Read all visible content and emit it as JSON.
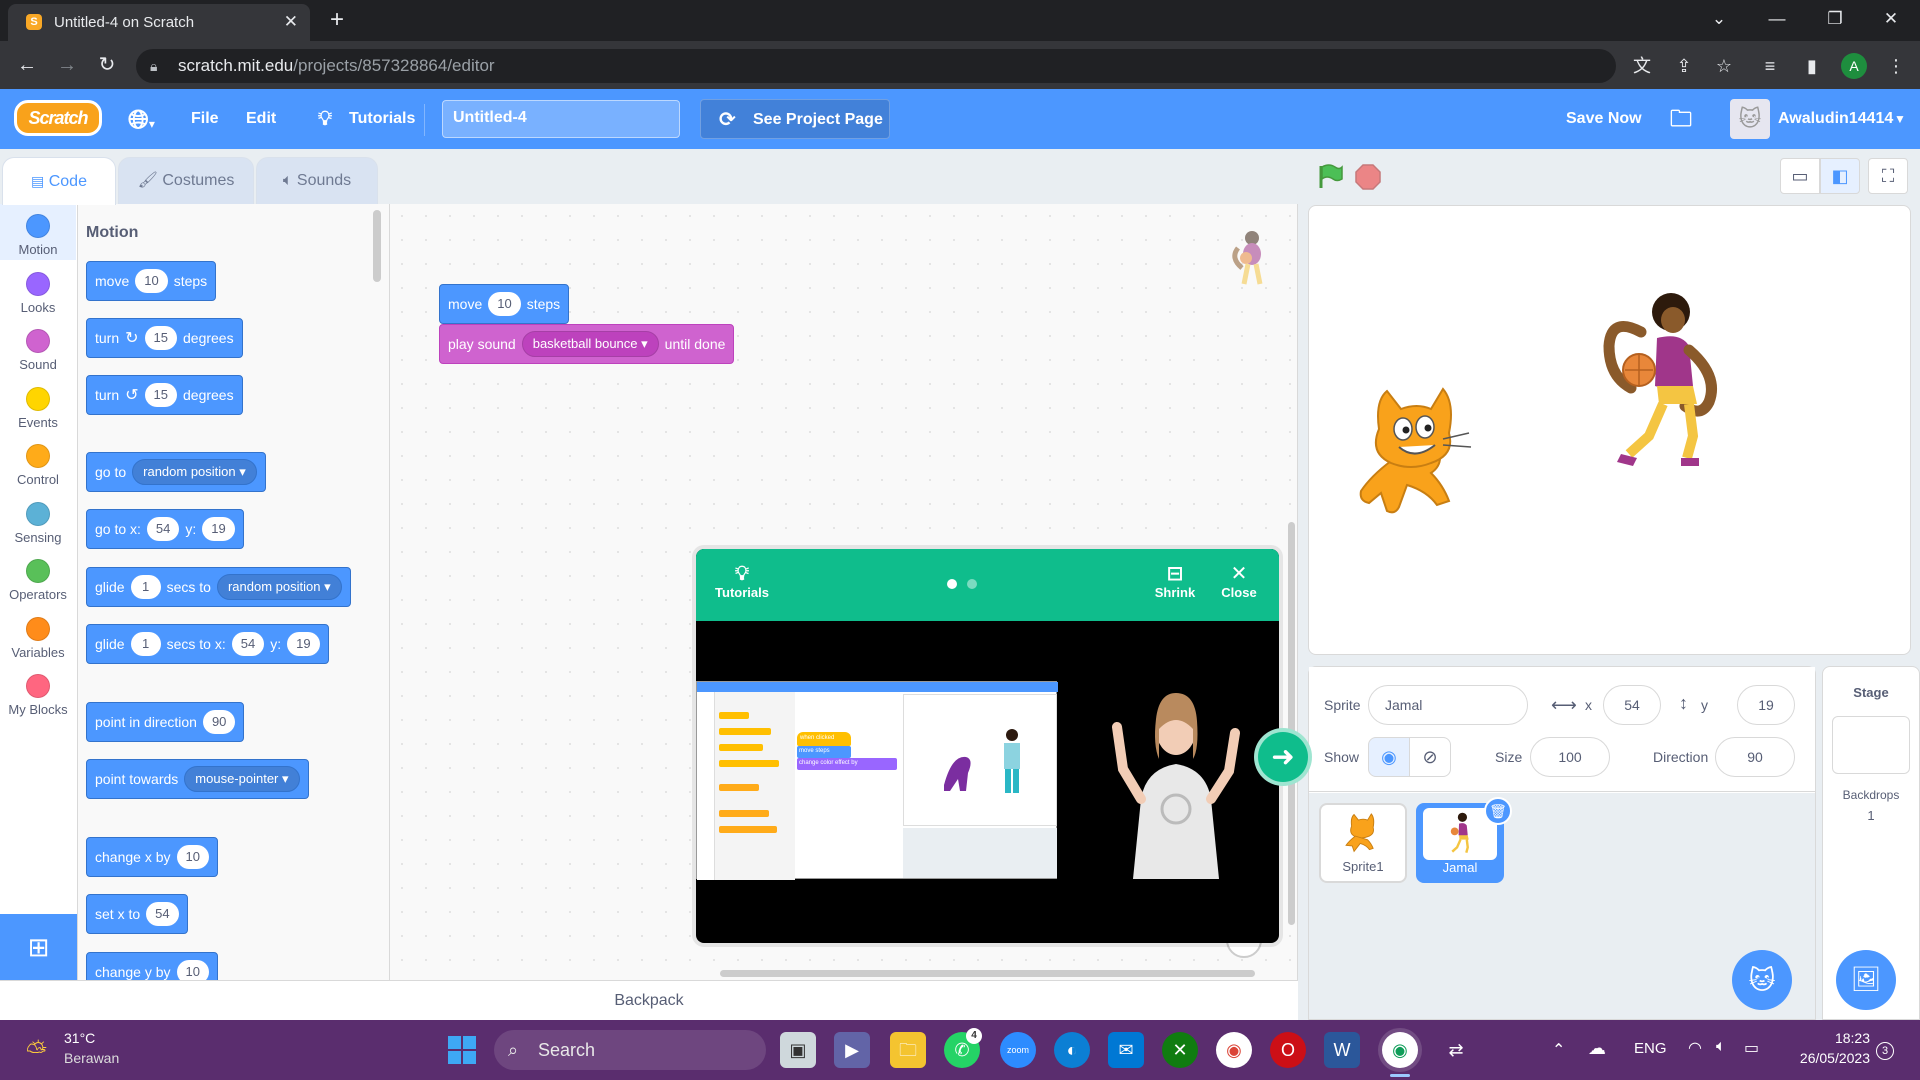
{
  "browser": {
    "tab_title": "Untitled-4 on Scratch",
    "tab_close": "✕",
    "new_tab": "+",
    "url_host": "scratch.mit.edu",
    "url_path": "/projects/857328864/editor",
    "profile_initial": "A"
  },
  "menubar": {
    "logo": "Scratch",
    "file": "File",
    "edit": "Edit",
    "tutorials": "Tutorials",
    "project_title": "Untitled-4",
    "see_project_page": "See Project Page",
    "save_now": "Save Now",
    "username": "Awaludin14414"
  },
  "editor_tabs": [
    "Code",
    "Costumes",
    "Sounds"
  ],
  "categories": [
    {
      "label": "Motion",
      "color": "#4c97ff"
    },
    {
      "label": "Looks",
      "color": "#9966ff"
    },
    {
      "label": "Sound",
      "color": "#cf63cf"
    },
    {
      "label": "Events",
      "color": "#ffd500"
    },
    {
      "label": "Control",
      "color": "#ffab19"
    },
    {
      "label": "Sensing",
      "color": "#5cb1d6"
    },
    {
      "label": "Operators",
      "color": "#59c059"
    },
    {
      "label": "Variables",
      "color": "#ff8c1a"
    },
    {
      "label": "My Blocks",
      "color": "#ff6680"
    }
  ],
  "palette": {
    "heading": "Motion",
    "move": {
      "a": "move",
      "v": "10",
      "b": "steps"
    },
    "turn_right": {
      "a": "turn",
      "v": "15",
      "b": "degrees"
    },
    "turn_left": {
      "a": "turn",
      "v": "15",
      "b": "degrees"
    },
    "goto": {
      "a": "go to",
      "dd": "random position"
    },
    "goto_xy": {
      "a": "go to x:",
      "x": "54",
      "b": "y:",
      "y": "19"
    },
    "glide_to": {
      "a": "glide",
      "v": "1",
      "b": "secs to",
      "dd": "random position"
    },
    "glide_xy": {
      "a": "glide",
      "v": "1",
      "b": "secs to x:",
      "x": "54",
      "c": "y:",
      "y": "19"
    },
    "point_dir": {
      "a": "point in direction",
      "v": "90"
    },
    "point_towards": {
      "a": "point towards",
      "dd": "mouse-pointer"
    },
    "change_x": {
      "a": "change x by",
      "v": "10"
    },
    "set_x": {
      "a": "set x to",
      "v": "54"
    },
    "change_y": {
      "a": "change y by",
      "v": "10"
    }
  },
  "script": {
    "move": {
      "a": "move",
      "v": "10",
      "b": "steps"
    },
    "play_sound": {
      "a": "play sound",
      "dd": "basketball bounce",
      "b": "until done"
    }
  },
  "backpack": "Backpack",
  "tutorial": {
    "tutorials": "Tutorials",
    "shrink": "Shrink",
    "close": "Close",
    "mini_when_clicked": "when clicked",
    "mini_move": "move",
    "mini_steps": "steps",
    "mini_change": "change color effect by"
  },
  "sprite_info": {
    "sprite_label": "Sprite",
    "sprite_name": "Jamal",
    "x_label": "x",
    "x": "54",
    "y_label": "y",
    "y": "19",
    "show_label": "Show",
    "size_label": "Size",
    "size": "100",
    "direction_label": "Direction",
    "direction": "90"
  },
  "sprites": [
    {
      "name": "Sprite1",
      "selected": false
    },
    {
      "name": "Jamal",
      "selected": true
    }
  ],
  "stage_pane": {
    "label": "Stage",
    "backdrops_label": "Backdrops",
    "backdrops_count": "1"
  },
  "taskbar": {
    "temp": "31°C",
    "weather": "Berawan",
    "search": "Search",
    "whatsapp_badge": "4",
    "lang": "ENG",
    "time": "18:23",
    "date": "26/05/2023",
    "notif": "3"
  }
}
